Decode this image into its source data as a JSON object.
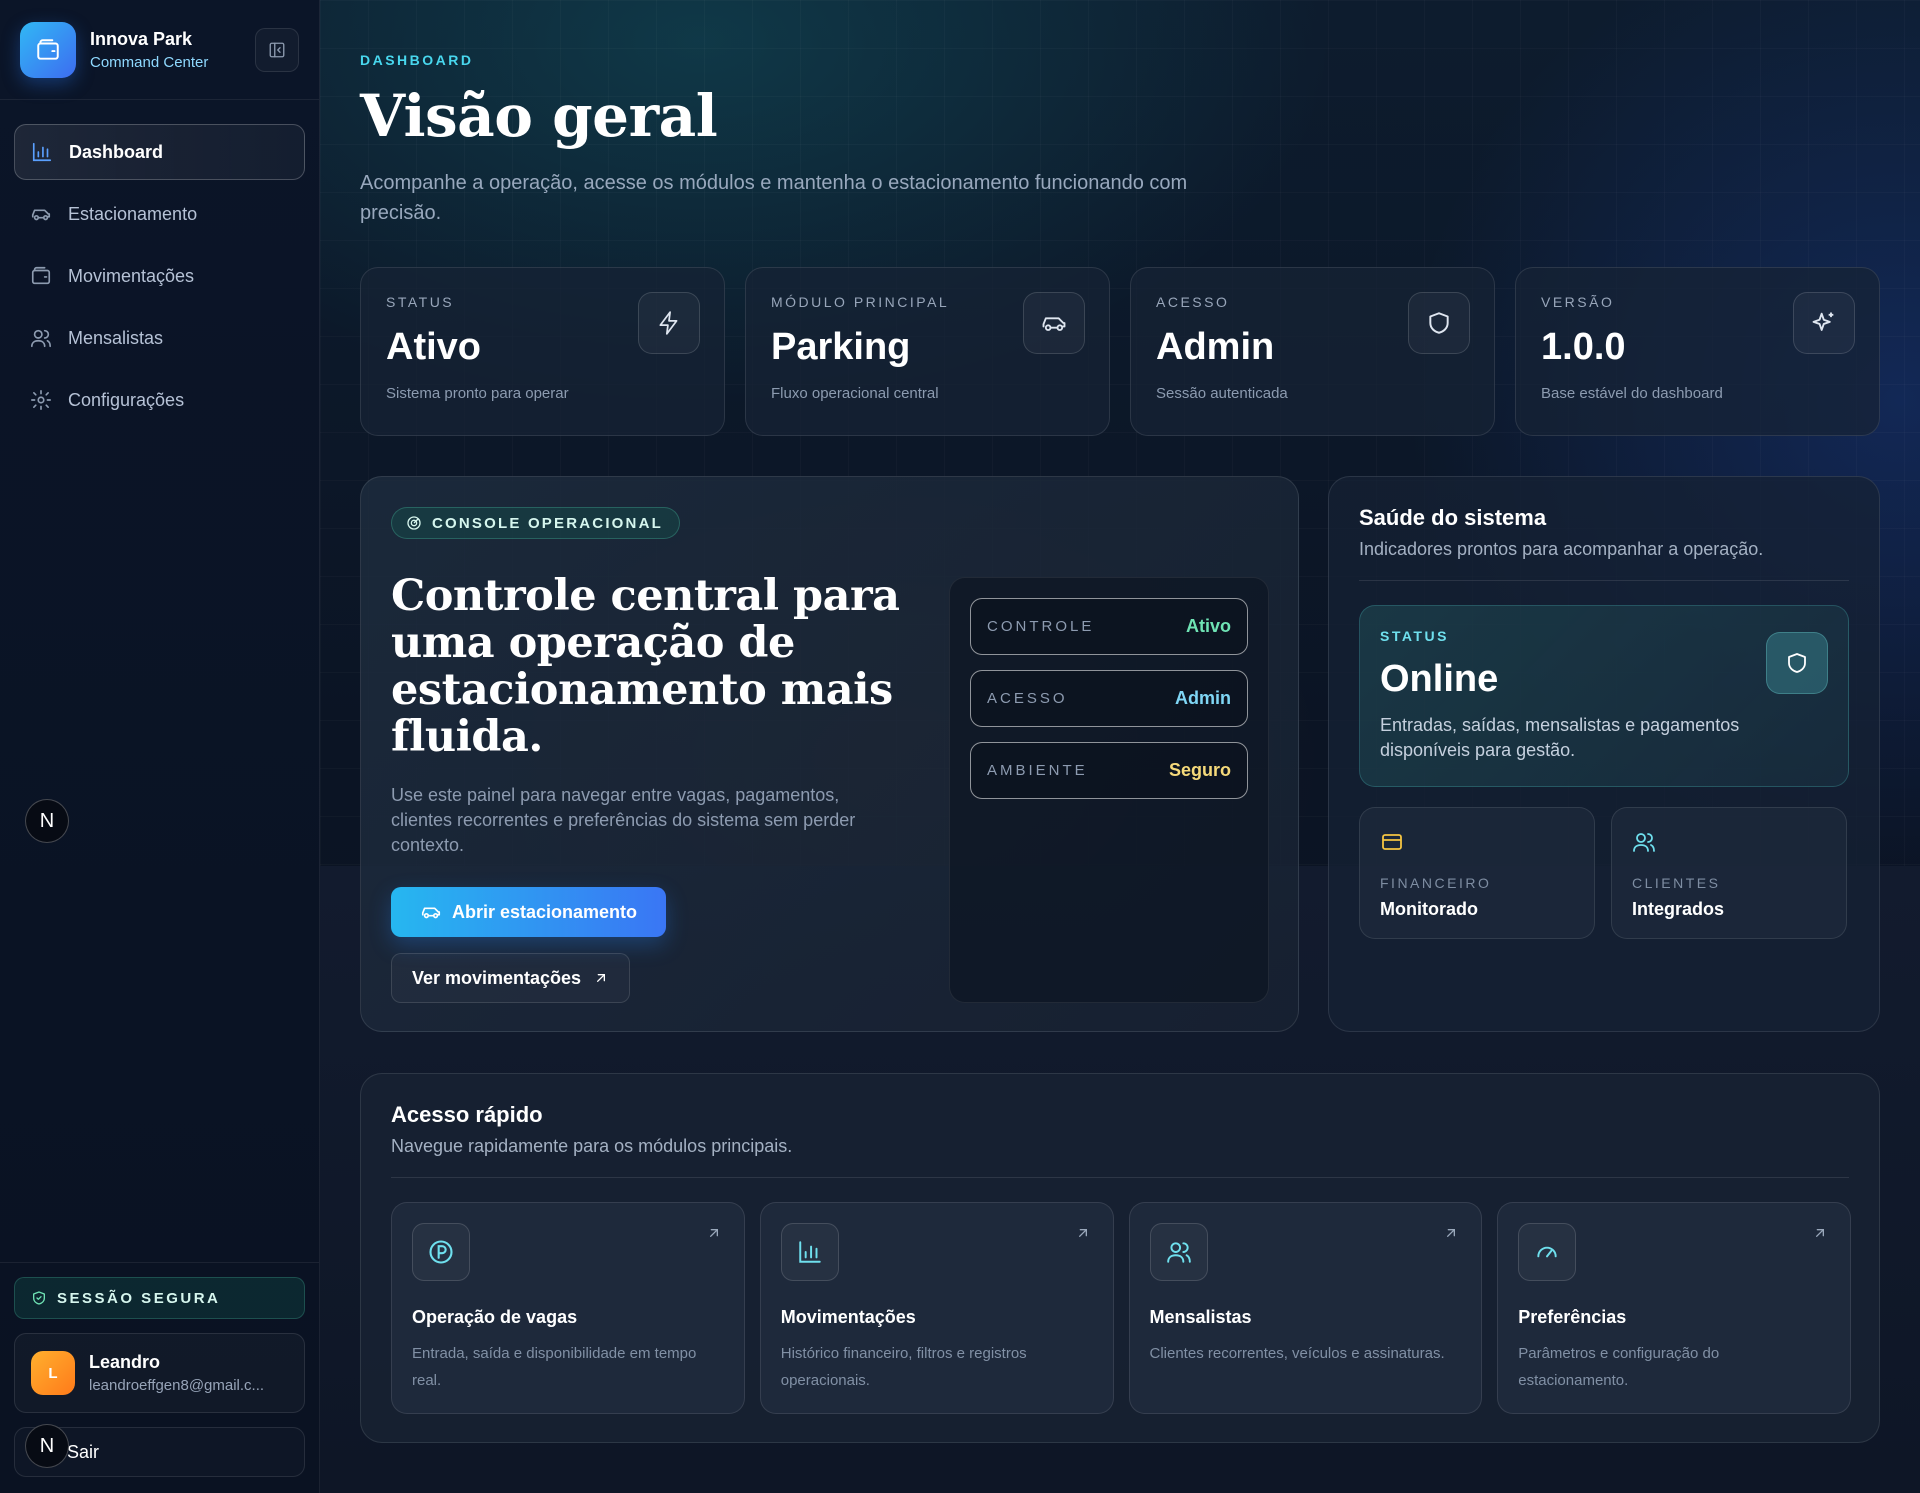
{
  "brand": {
    "name": "Innova Park",
    "subtitle": "Command Center"
  },
  "nav": [
    {
      "label": "Dashboard",
      "icon": "chart-bars-icon",
      "active": true
    },
    {
      "label": "Estacionamento",
      "icon": "car-icon"
    },
    {
      "label": "Movimentações",
      "icon": "wallet-icon"
    },
    {
      "label": "Mensalistas",
      "icon": "users-icon"
    },
    {
      "label": "Configurações",
      "icon": "gear-icon"
    }
  ],
  "badge": {
    "letter": "N"
  },
  "session": {
    "label": "SESSÃO SEGURA"
  },
  "user": {
    "initial": "L",
    "name": "Leandro",
    "email": "leandroeffgen8@gmail.c..."
  },
  "logout": {
    "label": "Sair"
  },
  "header": {
    "eyebrow": "DASHBOARD",
    "title": "Visão geral",
    "description": "Acompanhe a operação, acesse os módulos e mantenha o estacionamento funcionando com precisão."
  },
  "stats": [
    {
      "label": "STATUS",
      "value": "Ativo",
      "sub": "Sistema pronto para operar",
      "icon": "bolt-icon"
    },
    {
      "label": "MÓDULO PRINCIPAL",
      "value": "Parking",
      "sub": "Fluxo operacional central",
      "icon": "car-icon"
    },
    {
      "label": "ACESSO",
      "value": "Admin",
      "sub": "Sessão autenticada",
      "icon": "shield-icon"
    },
    {
      "label": "VERSÃO",
      "value": "1.0.0",
      "sub": "Base estável do dashboard",
      "icon": "sparkles-icon"
    }
  ],
  "console": {
    "pill": "CONSOLE OPERACIONAL",
    "title": "Controle central para uma operação de estacionamento mais fluida.",
    "description": "Use este painel para navegar entre vagas, pagamentos, clientes recorrentes e preferências do sistema sem perder contexto.",
    "primary_button": "Abrir estacionamento",
    "secondary_button": "Ver movimentações",
    "controls": [
      {
        "label": "CONTROLE",
        "value": "Ativo",
        "color": "#6fe3b4"
      },
      {
        "label": "ACESSO",
        "value": "Admin",
        "color": "#7fd6f5"
      },
      {
        "label": "AMBIENTE",
        "value": "Seguro",
        "color": "#f5d97a"
      }
    ]
  },
  "health": {
    "title": "Saúde do sistema",
    "subtitle": "Indicadores prontos para acompanhar a operação.",
    "status_label": "STATUS",
    "status_value": "Online",
    "status_desc": "Entradas, saídas, mensalistas e pagamentos disponíveis para gestão.",
    "cards": [
      {
        "label": "FINANCEIRO",
        "value": "Monitorado",
        "icon": "credit-card-icon",
        "color": "#f5c542"
      },
      {
        "label": "CLIENTES",
        "value": "Integrados",
        "icon": "users-icon",
        "color": "#6fe0ee"
      }
    ]
  },
  "quick": {
    "title": "Acesso rápido",
    "subtitle": "Navegue rapidamente para os módulos principais.",
    "items": [
      {
        "title": "Operação de vagas",
        "desc": "Entrada, saída e disponibilidade em tempo real.",
        "icon": "parking-icon"
      },
      {
        "title": "Movimentações",
        "desc": "Histórico financeiro, filtros e registros operacionais.",
        "icon": "chart-bars-icon"
      },
      {
        "title": "Mensalistas",
        "desc": "Clientes recorrentes, veículos e assinaturas.",
        "icon": "users-icon"
      },
      {
        "title": "Preferências",
        "desc": "Parâmetros e configuração do estacionamento.",
        "icon": "gauge-icon"
      }
    ]
  }
}
